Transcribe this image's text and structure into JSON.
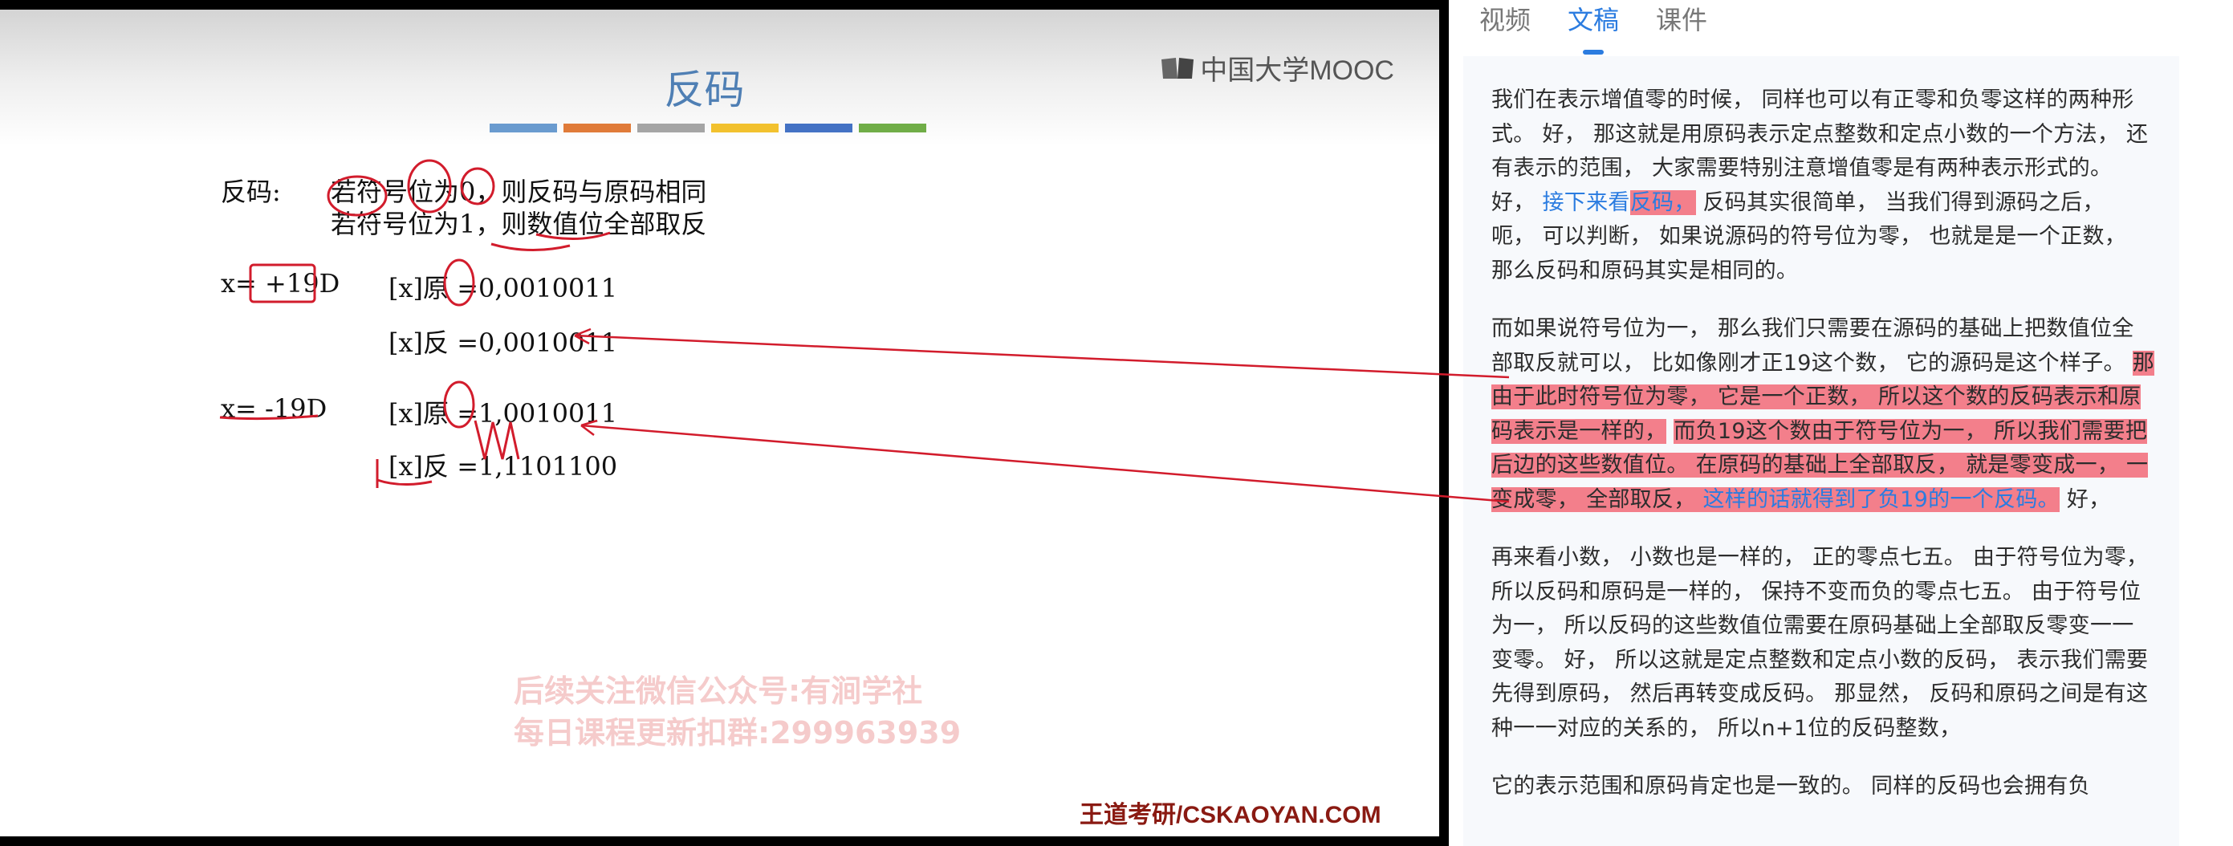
{
  "slide": {
    "logo": "中国大学MOOC",
    "title": "反码",
    "bar_colors": [
      "#6a9bcf",
      "#e07b39",
      "#a5a5a5",
      "#f2c12e",
      "#4472c4",
      "#70ad47"
    ],
    "def_label": "反码:",
    "def_line1": "若符号位为0，则反码与原码相同",
    "def_line2": "若符号位为1，则数值位全部取反",
    "ex1_x": "x= +19D",
    "ex1_orig": "[x]原 =0,0010011",
    "ex1_inv": "[x]反 =0,0010011",
    "ex2_x": "x= -19D",
    "ex2_orig": "[x]原 =1,0010011",
    "ex2_inv": "[x]反 =1,1101100",
    "watermark1": "后续关注微信公众号:有涧学社",
    "watermark2": "每日课程更新扣群:299963939",
    "footer": "王道考研/CSKAOYAN.COM"
  },
  "tabs": [
    "视频",
    "文稿",
    "课件"
  ],
  "active_tab": "文稿",
  "transcript": {
    "p1_a": "我们在表示增值零的时候， 同样也可以有正零和负零这样的两种形式。 好， 那这就是用原码表示定点整数和定点小数的一个方法， 还有表示的范围， 大家需要特别注意增值零是有两种表示形式的。 好， ",
    "p1_blue": "接下来看",
    "p1_hl": "反码，",
    "p1_b": " 反码其实很简单， 当我们得到源码之后， 呃， 可以判断， 如果说源码的符号位为零， 也就是是一个正数， 那么反码和原码其实是相同的。",
    "p2_a": "而如果说符号位为一， 那么我们只需要在源码的基础上把数值位全部取反就可以， 比如像刚才正19这个数， 它的源码是这个样子。 ",
    "p2_hl1": "那由于此时符号位为零， 它是一个正数， 所以这个数的反码表示和原码表示是一样的，",
    "p2_gap": "  ",
    "p2_hl2": "而负19这个数由于符号位为一， 所以我们需要把后边的这些数值位。 在原码的基础上全部取反， 就是零变成一， 一变成零， 全部取反， ",
    "p2_hl_blue": "这样的话就得到了负19的一个反码。",
    "p2_end": " 好，",
    "p3": "再来看小数， 小数也是一样的， 正的零点七五。 由于符号位为零， 所以反码和原码是一样的， 保持不变而负的零点七五。 由于符号位为一， 所以反码的这些数值位需要在原码基础上全部取反零变一一变零。 好， 所以这就是定点整数和定点小数的反码， 表示我们需要先得到原码， 然后再转变成反码。 那显然， 反码和原码之间是有这种一一对应的关系的， 所以n+1位的反码整数，",
    "p4": "它的表示范围和原码肯定也是一致的。 同样的反码也会拥有负"
  },
  "colors": {
    "accent": "#2b7ce0",
    "highlight": "#f37f8b",
    "slide_red": "#c21b2c",
    "title_blue": "#4f7fb4"
  }
}
